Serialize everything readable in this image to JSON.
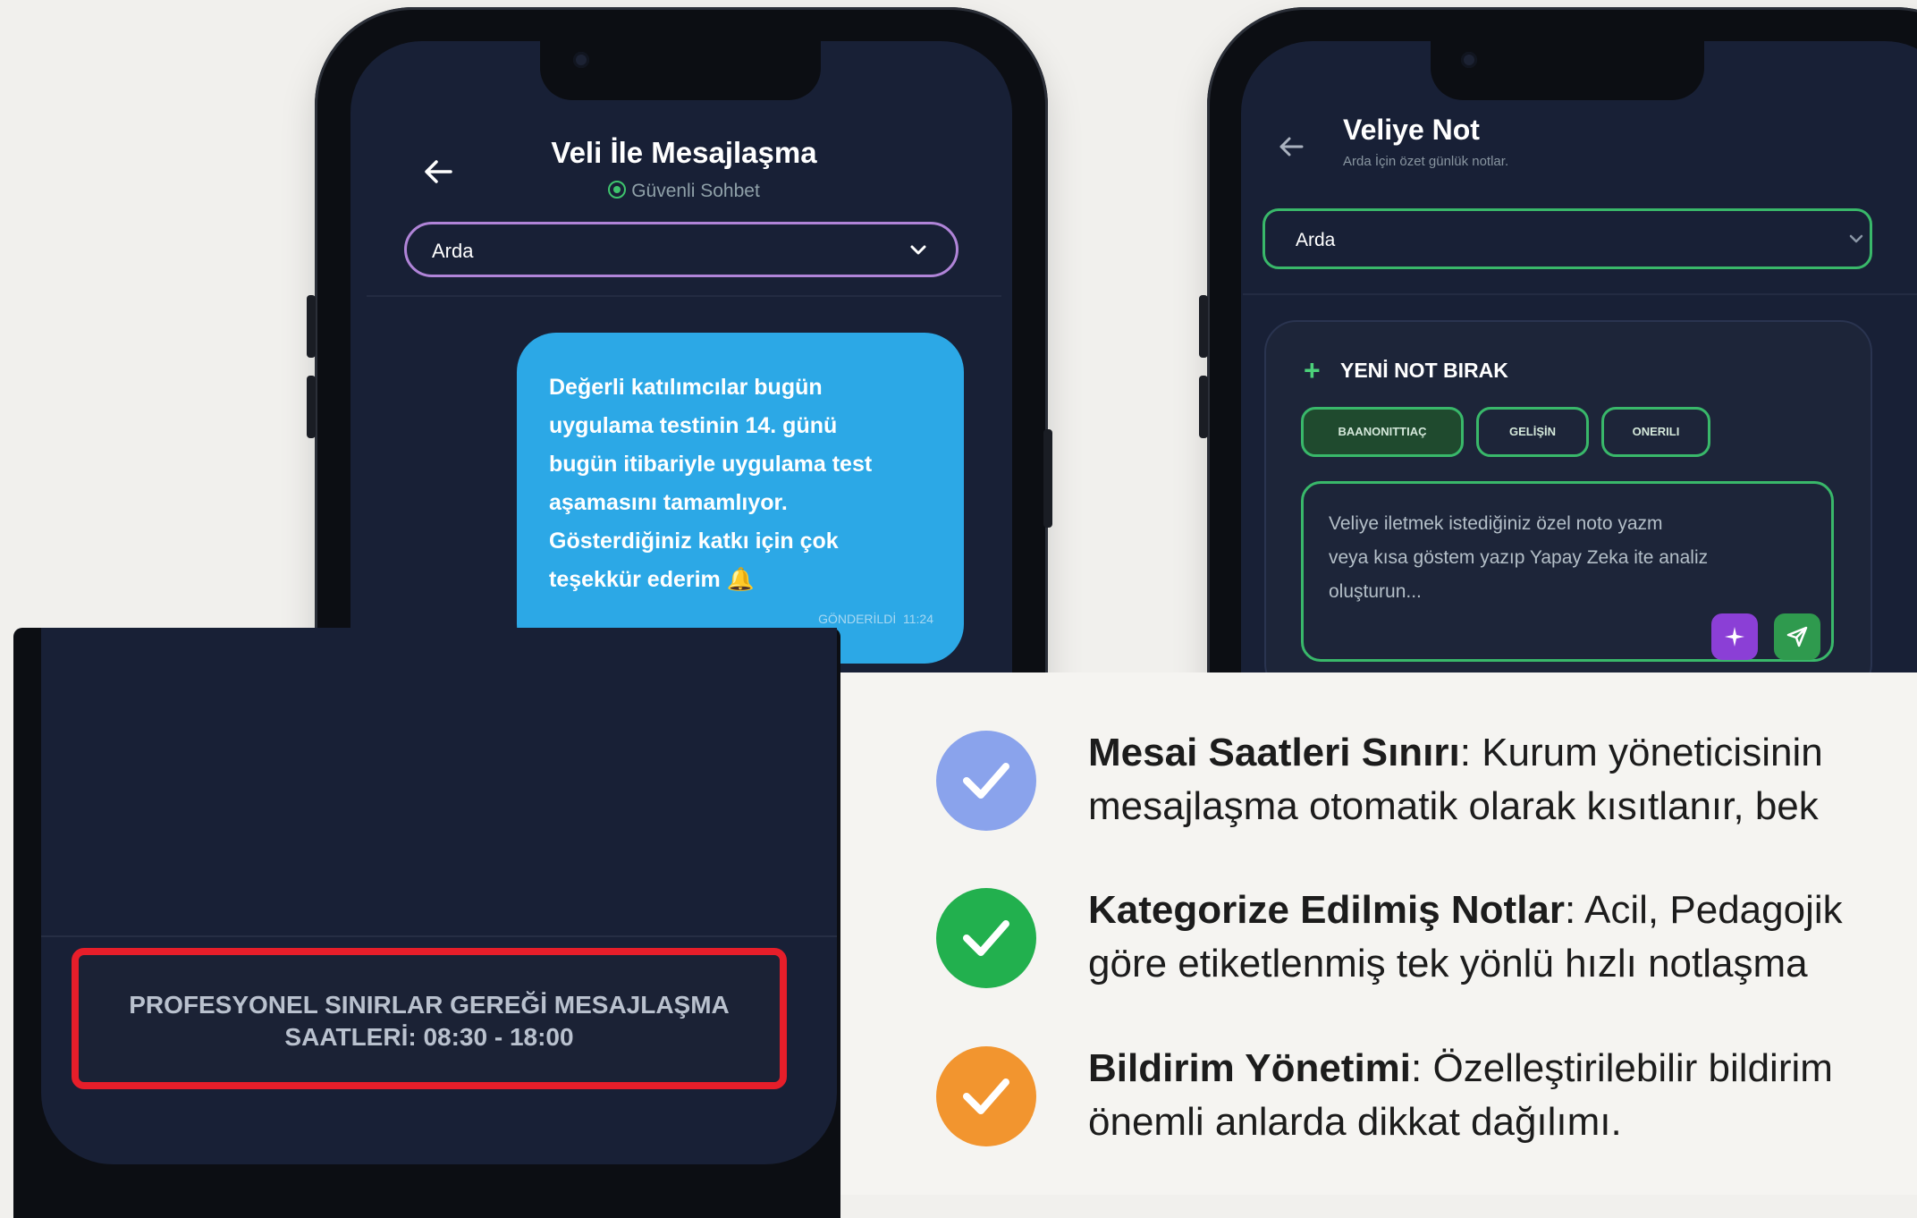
{
  "chat_screen": {
    "title": "Veli İle Mesajlaşma",
    "subtitle": "Güvenli Sohbet",
    "selected_student": "Arda",
    "message": {
      "lines": [
        "Değerli katılımcılar bugün",
        "uygulama testinin 14. günü",
        "bugün itibariyle uygulama test",
        "aşamasını tamamlıyor.",
        "Gösterdiğiniz katkı için çok",
        "teşekkür ederim 🔔"
      ],
      "status": "GÖNDERİLDİ",
      "time": "11:24"
    }
  },
  "note_screen": {
    "title": "Veliye Not",
    "subtitle": "Arda İçin özet günlük notlar.",
    "selected_student": "Arda",
    "section_title": "YENİ NOT BIRAK",
    "chips": [
      "BAANONITTIAÇ",
      "GELİŞİN",
      "ONERILI"
    ],
    "textarea_placeholder_lines": [
      "Veliye iletmek istediğiniz özel noto yazm",
      "veya kısa göstem yazıp Yapay Zeka ite analiz",
      "oluşturun..."
    ],
    "colors": {
      "accent": "#39b86a",
      "ai_button": "#8b3fd6",
      "send_button": "#2f9a4e"
    }
  },
  "restriction_screen": {
    "banner_lines": [
      "PROFESYONEL SINIRLAR GEREĞİ MESAJLAŞMA",
      "SAATLERİ: 08:30 - 18:00"
    ],
    "banner_color": "#e61e2a"
  },
  "features": [
    {
      "title": "Mesai Saatleri Sınırı",
      "line1": ": Kurum yöneticisinin",
      "line2": "mesajlaşma otomatik olarak kısıtlanır, bek",
      "icon": "check-icon",
      "color": "#8aa3ec"
    },
    {
      "title": "Kategorize Edilmiş Notlar",
      "line1": ": Acil, Pedagojik",
      "line2": "göre etiketlenmiş tek yönlü hızlı notlaşma",
      "icon": "check-icon",
      "color": "#22b04e"
    },
    {
      "title": "Bildirim Yönetimi",
      "line1": ": Özelleştirilebilir bildirim",
      "line2": "önemli anlarda dikkat dağılımı.",
      "icon": "check-icon",
      "color": "#f2952f"
    }
  ]
}
